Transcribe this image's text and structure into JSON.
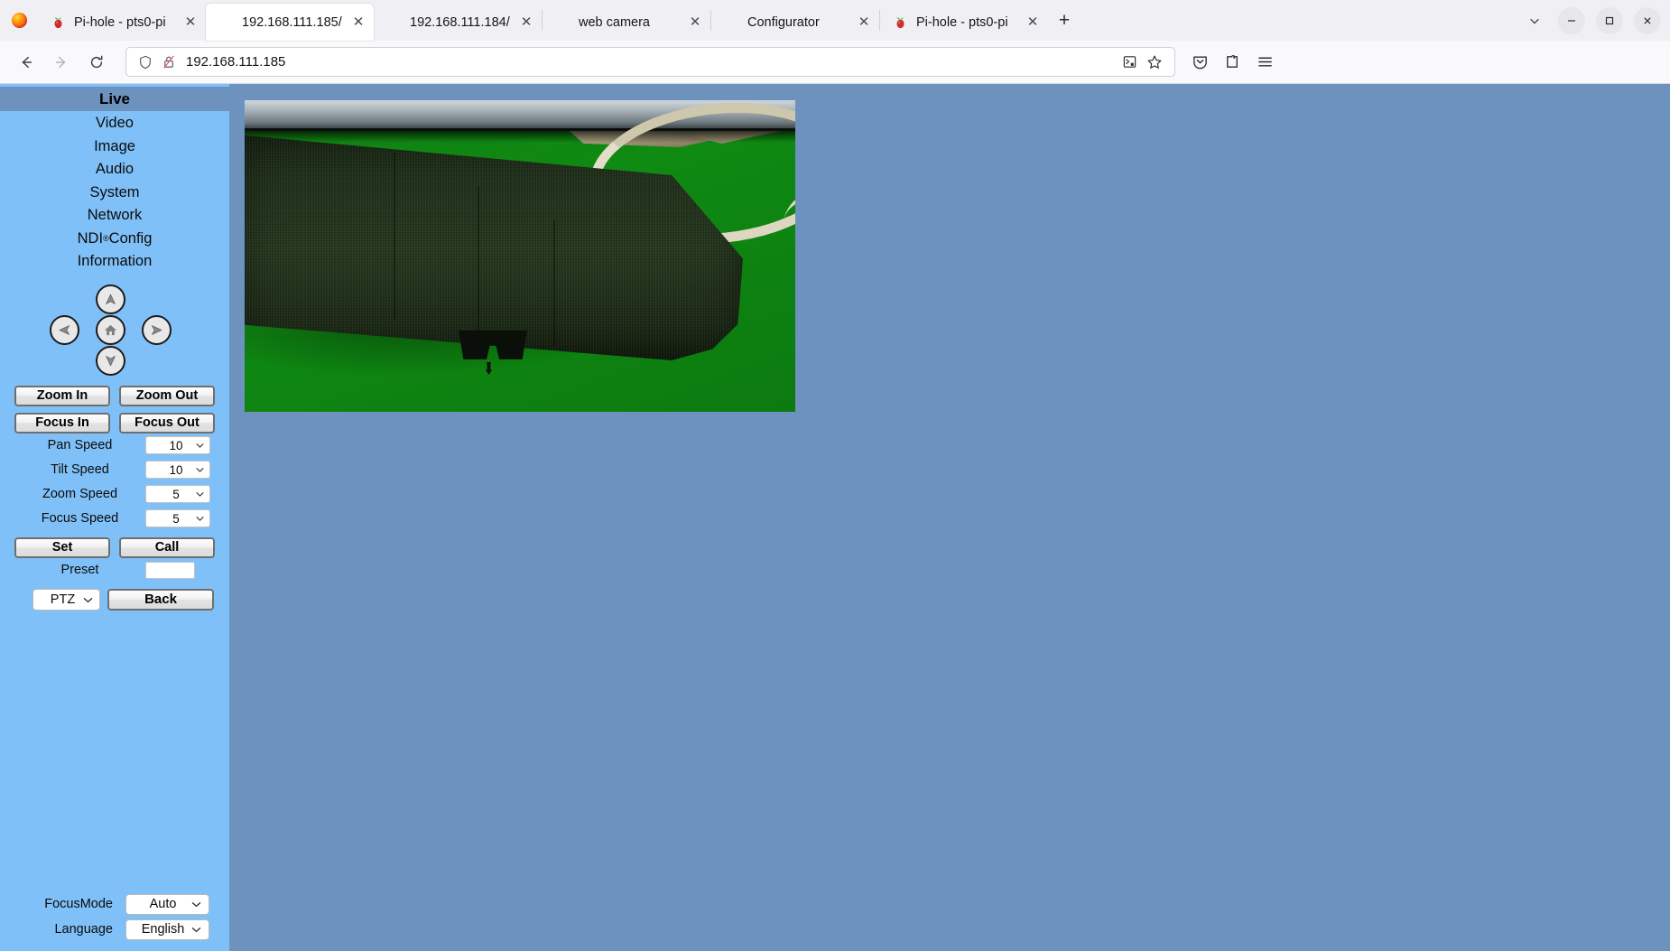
{
  "browser": {
    "tabs": [
      {
        "title": "Pi-hole - pts0-pi",
        "favicon": "pihole-icon",
        "active": false
      },
      {
        "title": "192.168.111.185/",
        "favicon": "none",
        "active": true
      },
      {
        "title": "192.168.111.184/",
        "favicon": "none",
        "active": false
      },
      {
        "title": "web camera",
        "favicon": "none",
        "active": false
      },
      {
        "title": "Configurator",
        "favicon": "none",
        "active": false
      },
      {
        "title": "Pi-hole - pts0-pi",
        "favicon": "pihole-icon",
        "active": false
      }
    ],
    "tab_close_label": "✕",
    "new_tab_label": "+",
    "list_all_tabs_label": "⌄",
    "window_controls": {
      "minimize": "—",
      "maximize": "❐",
      "close": "✕"
    },
    "nav": {
      "back": "←",
      "forward": "→",
      "reload": "⟳"
    },
    "url": "192.168.111.185",
    "url_shield_icon": "shield-icon",
    "url_lock_icon": "broken-lock-icon",
    "url_reader_icon": "reader-view-icon",
    "url_bookmark_icon": "bookmark-star-icon",
    "toolbar_icons": [
      "pocket-save-icon",
      "extensions-icon",
      "app-menu-icon"
    ]
  },
  "page": {
    "sidebar": {
      "header": "Live",
      "nav_items": [
        {
          "label": "Video"
        },
        {
          "label": "Image"
        },
        {
          "label": "Audio"
        },
        {
          "label": "System"
        },
        {
          "label": "Network"
        },
        {
          "label": "NDI",
          "sup": "®",
          "suffix": " Config"
        },
        {
          "label": "Information"
        }
      ],
      "ptz": {
        "up": "pan-up",
        "left": "pan-left",
        "home": "home",
        "right": "pan-right",
        "down": "pan-down"
      },
      "buttons": {
        "zoom_in": "Zoom In",
        "zoom_out": "Zoom Out",
        "focus_in": "Focus In",
        "focus_out": "Focus Out",
        "set": "Set",
        "call": "Call",
        "back": "Back"
      },
      "speeds": [
        {
          "label": "Pan Speed",
          "value": "10"
        },
        {
          "label": "Tilt Speed",
          "value": "10"
        },
        {
          "label": "Zoom Speed",
          "value": "5"
        },
        {
          "label": "Focus Speed",
          "value": "5"
        }
      ],
      "preset": {
        "label": "Preset",
        "value": ""
      },
      "mode_select": {
        "value": "PTZ"
      },
      "focus_mode": {
        "label": "FocusMode",
        "value": "Auto"
      },
      "language": {
        "label": "Language",
        "value": "English"
      },
      "caret": "⌄"
    },
    "video": {
      "alt": "live-camera-feed"
    },
    "colors": {
      "sidebar_bg": "#80c0f8",
      "content_bg": "#6d92bd",
      "header_band": "#6d92bd",
      "chroma_green": "#108013"
    }
  }
}
